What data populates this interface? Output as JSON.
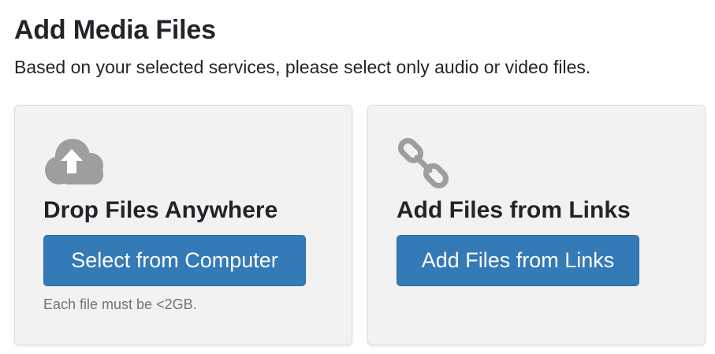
{
  "header": {
    "title": "Add Media Files",
    "subtitle": "Based on your selected services, please select only audio or video files."
  },
  "upload_card": {
    "icon": "cloud-upload-icon",
    "heading": "Drop Files Anywhere",
    "button_label": "Select from Computer",
    "note": "Each file must be <2GB."
  },
  "links_card": {
    "icon": "link-icon",
    "heading": "Add Files from Links",
    "button_label": "Add Files from Links"
  },
  "colors": {
    "button_bg": "#337ab7",
    "card_bg": "#f2f2f2",
    "icon_gray": "#9e9e9e"
  }
}
